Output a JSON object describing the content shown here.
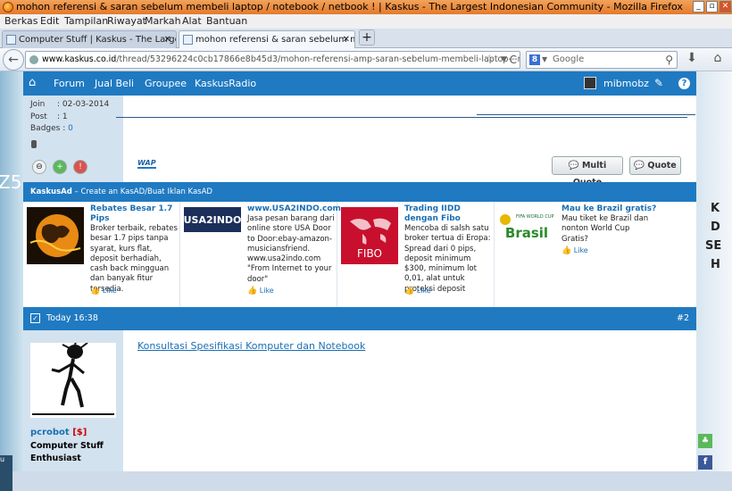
{
  "window": {
    "title": "mohon referensi & saran sebelum membeli laptop / notebook / netbook ! | Kaskus - The Largest Indonesian Community - Mozilla Firefox",
    "buttons": [
      "_",
      "▫",
      "✕"
    ]
  },
  "menu": [
    "Berkas",
    "Edit",
    "Tampilan",
    "Riwayat",
    "Markah",
    "Alat",
    "Bantuan"
  ],
  "tabs": [
    {
      "label": "Computer Stuff | Kaskus - The Largest Ind...",
      "close": "✕"
    },
    {
      "label": "mohon referensi & saran sebelum membeli l...",
      "close": "✕"
    }
  ],
  "newtab": "+",
  "nav": {
    "back": "←",
    "url_host": "www.kaskus.co.id",
    "url_path": "/thread/53296224c0cb17866e8b45d3/mohon-referensi-amp-saran-sebelum-membeli-laptop---notebook---netbo",
    "star": "☆",
    "reload": "C",
    "search_placeholder": "Google",
    "download": "⬇",
    "home": "⌂"
  },
  "kaskus": {
    "home": "⌂",
    "nav": [
      "Forum",
      "Jual Beli",
      "Groupee",
      "KaskusRadio"
    ],
    "username": "mibmobz",
    "edit": "✎",
    "help": "?"
  },
  "post1": {
    "join_label": "Join",
    "join_value": ": 02-03-2014",
    "post_label": "Post",
    "post_value": ": 1",
    "badges_label": "Badges :",
    "badges_value": "0",
    "wap": "WAP",
    "multi_quote": "Multi Quote",
    "quote": "Quote"
  },
  "adbar": {
    "title": "KaskusAd",
    "text": " – Create an KasAD/Buat Iklan KasAD"
  },
  "ads": [
    {
      "title": "Rebates Besar 1.7 Pips",
      "desc": "Broker terbaik, rebates besar 1.7 pips tanpa syarat, kurs flat, deposit berhadiah, cash back mingguan dan banyak fitur tersedia.",
      "like": "Like"
    },
    {
      "title": "www.USA2INDO.com",
      "desc": "Jasa pesan barang dari online store USA Door to Door:ebay-amazon-musiciansfriend. www.usa2indo.com \"From Internet to your door\"",
      "like": "Like",
      "logo": "USA2INDO"
    },
    {
      "title": "Trading IIDD dengan Fibo",
      "desc": "Mencoba di salsh satu broker tertua di Eropa: Spread dari 0 pips, deposit minimum $300, minimum lot 0,01, alat untuk proteksi deposit",
      "like": "Like",
      "logo": "FIBO"
    },
    {
      "title": "Mau ke Brazil gratis?",
      "desc": "Mau tiket ke Brazil dan nonton World Cup Gratis?",
      "like": "Like",
      "logo": "Brasil",
      "logo_small": "FIFA WORLD CUP"
    }
  ],
  "post2": {
    "date": "Today 16:38",
    "number": "#2",
    "username": "pcrobot",
    "dollar": "[$]",
    "rank": "Computer Stuff Enthusiast",
    "link": "Konsultasi Spesifikasi Komputer dan Notebook"
  },
  "bg": {
    "left_text": "Z5",
    "left_box": "u",
    "right_lines": [
      "K",
      "D",
      "SE",
      "H"
    ]
  },
  "colors": {
    "kaskus_blue": "#1f7ac2",
    "link": "#1a6fb5",
    "title_orange": "#e47a2a"
  }
}
